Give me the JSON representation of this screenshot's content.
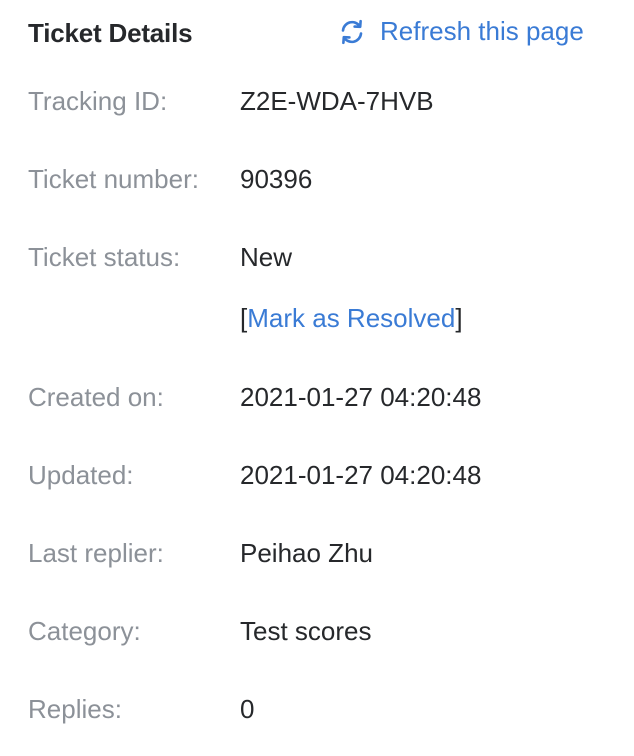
{
  "header": {
    "title": "Ticket Details",
    "refresh_label": "Refresh this page",
    "refresh_icon": "refresh-icon",
    "accent_color": "#3a7bd5"
  },
  "details": {
    "tracking_id": {
      "label": "Tracking ID:",
      "value": "Z2E-WDA-7HVB"
    },
    "ticket_number": {
      "label": "Ticket number:",
      "value": "90396"
    },
    "ticket_status": {
      "label": "Ticket status:",
      "value": "New"
    },
    "resolve": {
      "open_bracket": "[",
      "link": "Mark as Resolved",
      "close_bracket": "]"
    },
    "created_on": {
      "label": "Created on:",
      "value": "2021-01-27 04:20:48"
    },
    "updated": {
      "label": "Updated:",
      "value": "2021-01-27 04:20:48"
    },
    "last_replier": {
      "label": "Last replier:",
      "value": "Peihao Zhu"
    },
    "category": {
      "label": "Category:",
      "value": "Test scores"
    },
    "replies": {
      "label": "Replies:",
      "value": "0"
    }
  }
}
